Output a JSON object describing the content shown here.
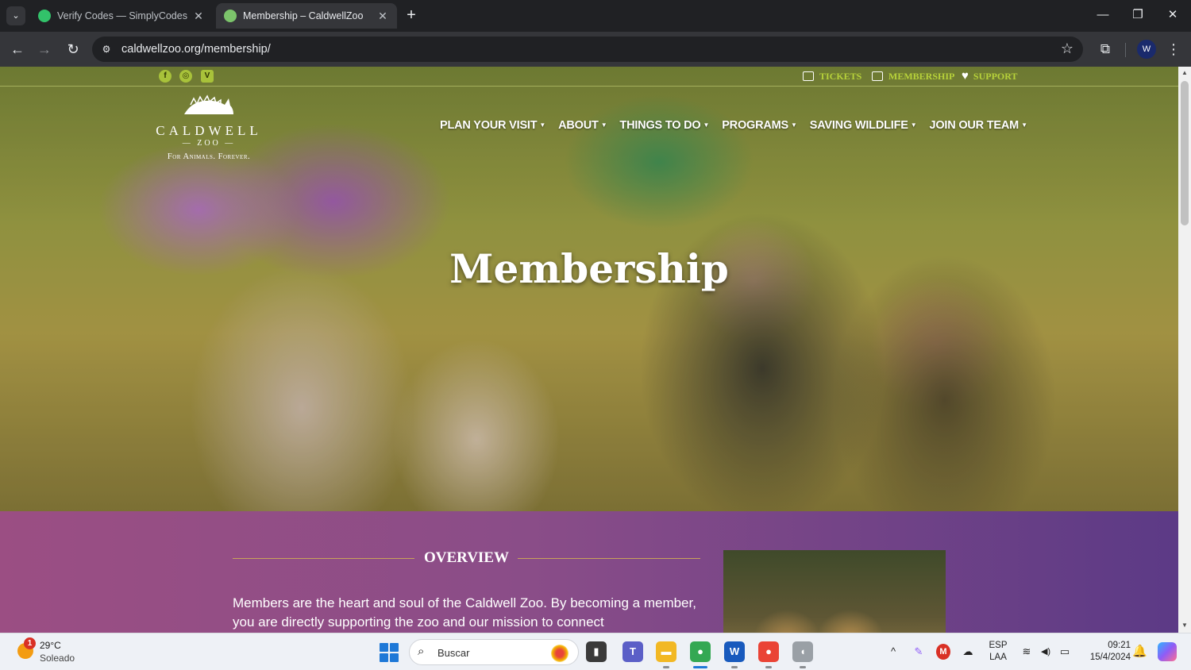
{
  "browser": {
    "tabs": [
      {
        "title": "Verify Codes — SimplyCodes",
        "active": false
      },
      {
        "title": "Membership – CaldwellZoo",
        "active": true
      }
    ],
    "url": "caldwellzoo.org/membership/",
    "icons": {
      "tab_search": "chevron-down-icon",
      "new_tab": "plus-icon",
      "back": "arrow-left-icon",
      "forward": "arrow-right-icon",
      "reload": "reload-icon",
      "site_info": "tune-icon",
      "bookmark": "star-icon",
      "extensions": "puzzle-icon",
      "menu": "kebab-menu-icon"
    },
    "glyphs": {
      "tab_search": "⌄",
      "close": "✕",
      "new_tab": "+",
      "minimize": "—",
      "restore": "❐",
      "close_window": "✕",
      "back": "←",
      "forward": "→",
      "reload": "↻",
      "site_info": "⚙",
      "star": "☆",
      "extensions": "⧉",
      "profile": "W",
      "menu": "⋮"
    }
  },
  "site": {
    "social": [
      {
        "name": "facebook",
        "glyph": "f"
      },
      {
        "name": "instagram",
        "glyph": "◎"
      },
      {
        "name": "vimeo",
        "glyph": "V"
      }
    ],
    "utility_links": {
      "tickets": "TICKETS",
      "membership": "MEMBERSHIP",
      "support": "SUPPORT",
      "support_glyph": "♥"
    },
    "logo": {
      "name": "CALDWELL",
      "zoo": "— ZOO —",
      "tagline": "For Animals. Forever."
    },
    "nav": [
      {
        "label": "PLAN YOUR VISIT"
      },
      {
        "label": "ABOUT"
      },
      {
        "label": "THINGS TO DO"
      },
      {
        "label": "PROGRAMS"
      },
      {
        "label": "SAVING WILDLIFE"
      },
      {
        "label": "JOIN OUR TEAM"
      }
    ],
    "nav_caret": "▼",
    "hero_title": "Membership",
    "overview": {
      "heading": "OVERVIEW",
      "text": "Members are the heart and soul of the Caldwell Zoo. By becoming a member, you are directly supporting the zoo and our mission to connect"
    },
    "colors": {
      "accent": "#b7d23a",
      "overview_start": "#9b4e83",
      "overview_end": "#5c3a86",
      "heading_line": "#c9a35a"
    }
  },
  "scrollbar": {
    "up": "▲",
    "down": "▼"
  },
  "taskbar": {
    "weather": {
      "temp": "29°C",
      "desc": "Soleado",
      "badge": "1"
    },
    "search_placeholder": "Buscar",
    "search_glyph": "⌕",
    "apps": [
      {
        "name": "task-view",
        "glyph": "▮",
        "color": "#3a3a3a"
      },
      {
        "name": "teams",
        "glyph": "T",
        "color": "#5b5fc7"
      },
      {
        "name": "file-explorer",
        "glyph": "▬",
        "color": "#f2b824"
      },
      {
        "name": "chrome",
        "glyph": "●",
        "color": "#34a853"
      },
      {
        "name": "word",
        "glyph": "W",
        "color": "#185abd"
      },
      {
        "name": "chrome-profile",
        "glyph": "●",
        "color": "#ea4335"
      },
      {
        "name": "mouse-app",
        "glyph": "◖",
        "color": "#9aa0a6"
      }
    ],
    "tray": {
      "chevron": "^",
      "pen": "✎",
      "m": "M",
      "cloud": "☁",
      "wifi": "≋",
      "volume": "◀)",
      "battery": "▭"
    },
    "lang_1": "ESP",
    "lang_2": "LAA",
    "time": "09:21",
    "date": "15/4/2024",
    "bell_glyph": "🔔"
  }
}
